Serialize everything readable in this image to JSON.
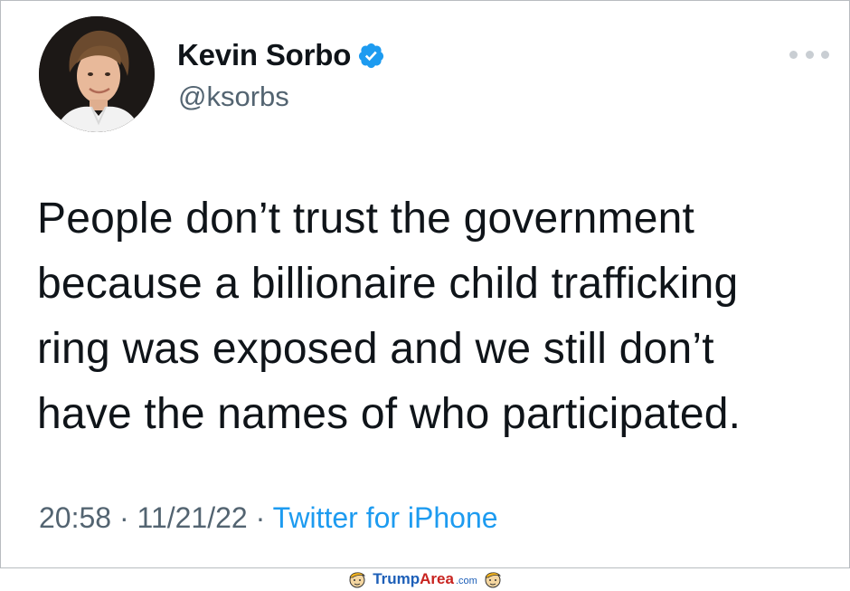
{
  "tweet": {
    "author": {
      "display_name": "Kevin Sorbo",
      "handle": "@ksorbs",
      "verified": true,
      "avatar_icon": "profile-photo"
    },
    "text_lines": [
      "People don’t trust the government",
      "because a billionaire child trafficking",
      "ring was exposed and we still don’t",
      "have the names of who participated."
    ],
    "time": "20:58",
    "separator": "·",
    "date": "11/21/22",
    "source": "Twitter for iPhone",
    "more_icon": "more-dots-icon"
  },
  "watermark": {
    "part1": "Trump",
    "part2": "Area",
    "part3": ".com"
  },
  "colors": {
    "accent": "#1d9bf0",
    "text": "#0f1419",
    "muted": "#536471",
    "brand_blue": "#1d5fb8",
    "brand_red": "#c8231f"
  }
}
